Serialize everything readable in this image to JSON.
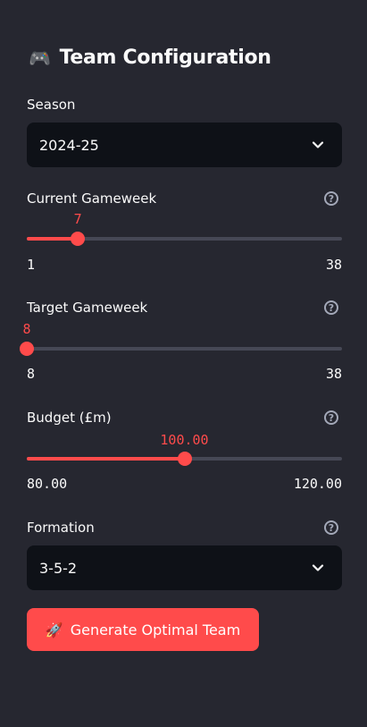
{
  "header": {
    "icon": "gamepad-icon",
    "title": "Team Configuration"
  },
  "season": {
    "label": "Season",
    "value": "2024-25"
  },
  "current_gameweek": {
    "label": "Current Gameweek",
    "value": "7",
    "min": "1",
    "max": "38",
    "fraction": 0.162
  },
  "target_gameweek": {
    "label": "Target Gameweek",
    "value": "8",
    "min": "8",
    "max": "38",
    "fraction": 0.0
  },
  "budget": {
    "label": "Budget (£m)",
    "value": "100.00",
    "min": "80.00",
    "max": "120.00",
    "fraction": 0.5
  },
  "formation": {
    "label": "Formation",
    "value": "3-5-2"
  },
  "generate": {
    "icon": "rocket-icon",
    "label": "Generate Optimal Team"
  },
  "help_glyph": "?",
  "colors": {
    "accent": "#ff4b4b",
    "background": "#262730",
    "input": "#0e1117"
  }
}
